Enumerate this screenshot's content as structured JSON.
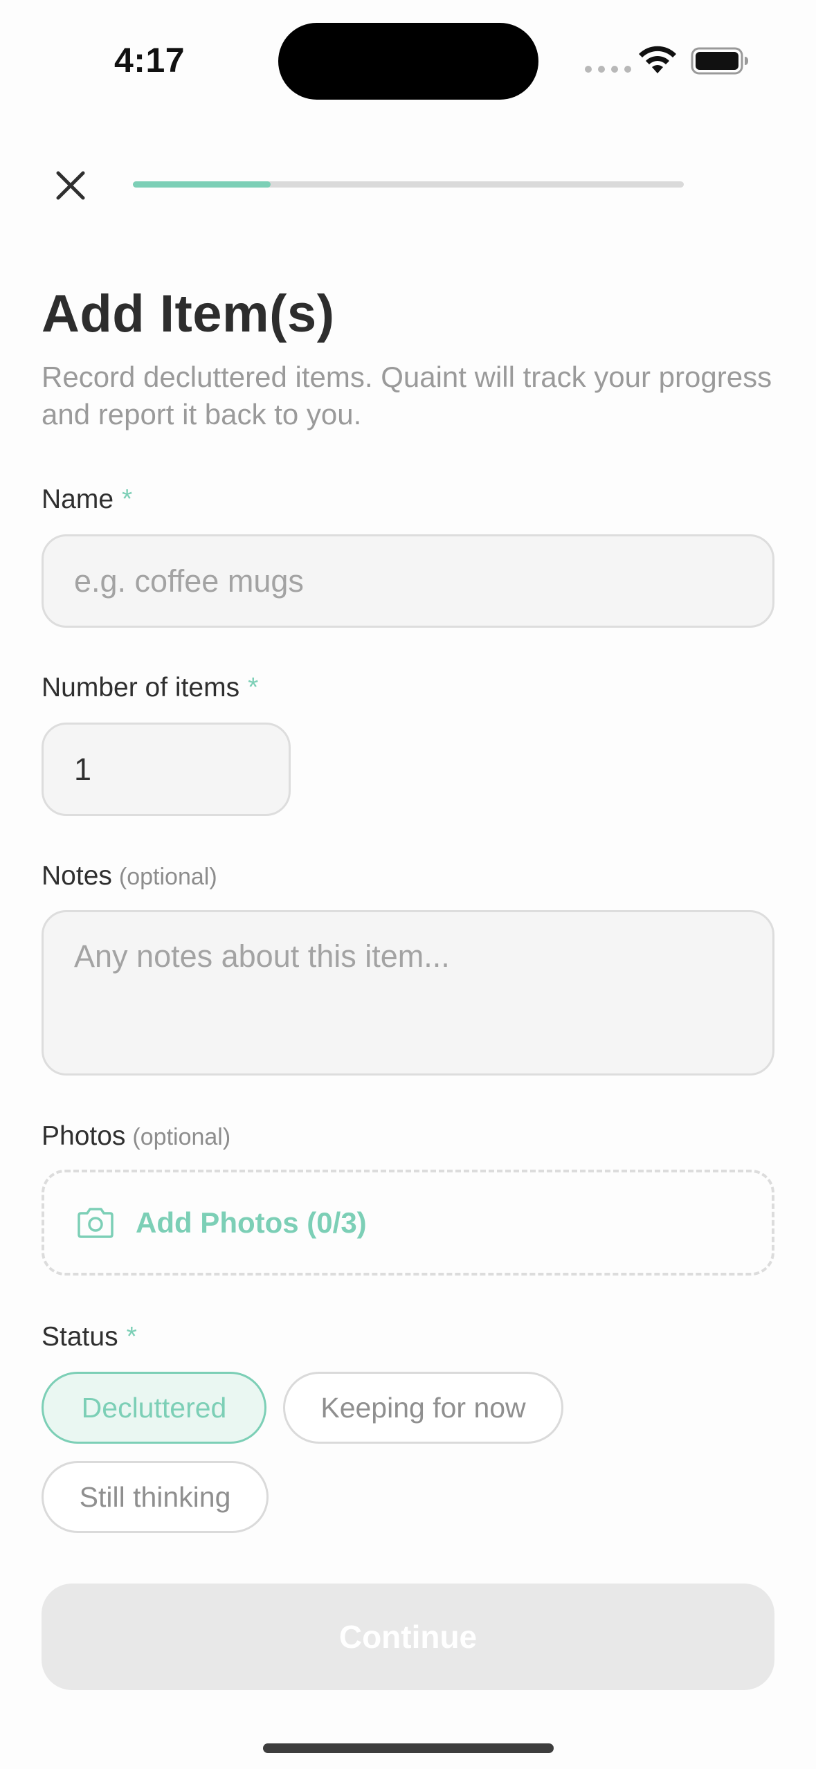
{
  "status_bar": {
    "time": "4:17"
  },
  "progress": {
    "fraction": 0.25
  },
  "header": {
    "title": "Add Item(s)",
    "subtitle": "Record decluttered items. Quaint will track your progress and report it back to you."
  },
  "form": {
    "name": {
      "label": "Name",
      "required_mark": "*",
      "placeholder": "e.g. coffee mugs",
      "value": ""
    },
    "quantity": {
      "label": "Number of items",
      "required_mark": "*",
      "value": "1"
    },
    "notes": {
      "label": "Notes",
      "optional_note": "(optional)",
      "placeholder": "Any notes about this item..."
    },
    "photos": {
      "label": "Photos",
      "optional_note": "(optional)",
      "button_label": "Add Photos (0/3)"
    },
    "status": {
      "label": "Status",
      "required_mark": "*",
      "options": [
        "Decluttered",
        "Keeping for now",
        "Still thinking"
      ],
      "selected": "Decluttered"
    }
  },
  "actions": {
    "continue_label": "Continue"
  },
  "colors": {
    "accent": "#7ccfb6",
    "disabled_button": "#e8e8e8",
    "text": "#2f2f2f",
    "muted": "#9a9a9a"
  },
  "icons": {
    "close": "close-icon",
    "camera": "camera-icon",
    "wifi": "wifi-icon",
    "battery": "battery-icon"
  }
}
